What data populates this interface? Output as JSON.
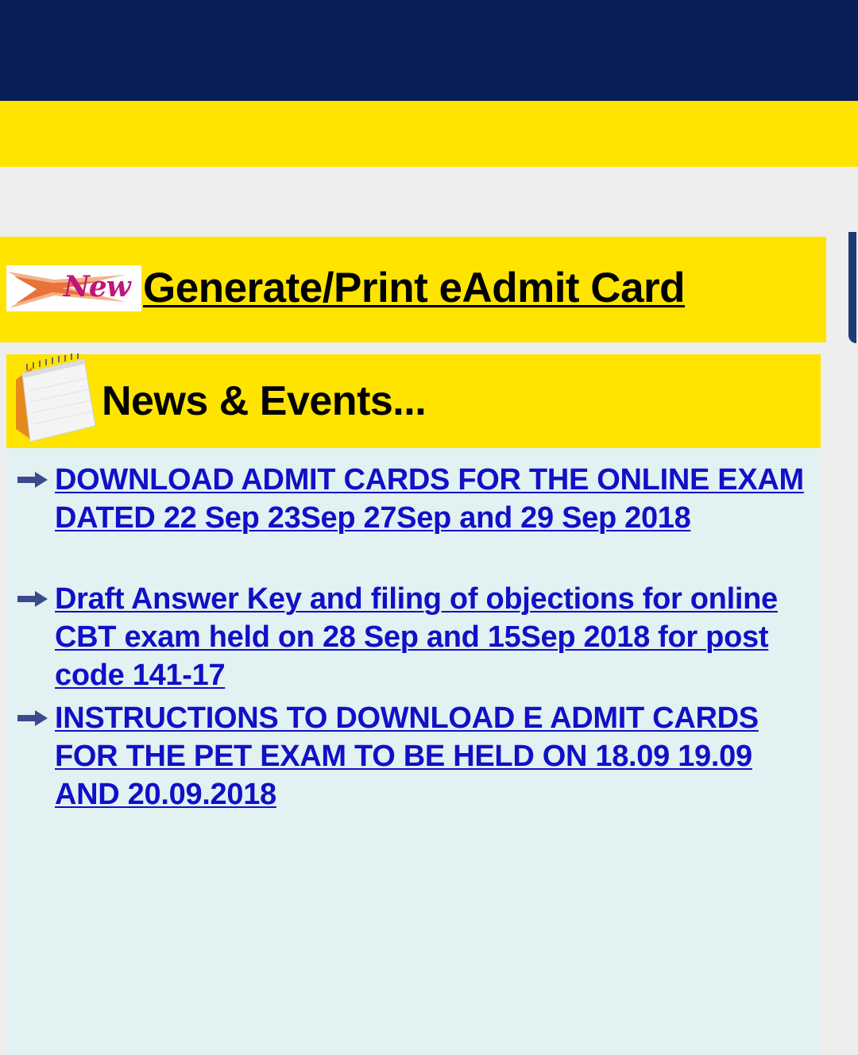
{
  "admit": {
    "badge_text": "New",
    "link_label": "Generate/Print eAdmit Card"
  },
  "news": {
    "title": "News & Events...",
    "items": [
      {
        "label": "DOWNLOAD ADMIT CARDS FOR THE ONLINE EXAM DATED 22 Sep 23Sep 27Sep and 29 Sep 2018"
      },
      {
        "label": "Draft Answer Key and filing of objections for online CBT exam held on 28 Sep and 15Sep 2018 for post code 141-17"
      },
      {
        "label": "INSTRUCTIONS TO DOWNLOAD E ADMIT CARDS FOR THE PET EXAM TO BE HELD ON 18.09 19.09 AND 20.09.2018"
      }
    ]
  },
  "colors": {
    "header_navy": "#0a1f57",
    "banner_yellow": "#ffe400",
    "news_panel": "#e2f1f1",
    "link_blue": "#1010c8",
    "badge_magenta": "#c0157a"
  }
}
